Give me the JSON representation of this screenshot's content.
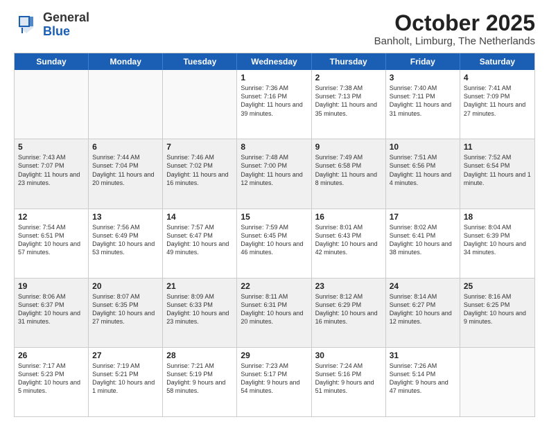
{
  "logo": {
    "general": "General",
    "blue": "Blue"
  },
  "header": {
    "month": "October 2025",
    "location": "Banholt, Limburg, The Netherlands"
  },
  "weekdays": [
    "Sunday",
    "Monday",
    "Tuesday",
    "Wednesday",
    "Thursday",
    "Friday",
    "Saturday"
  ],
  "rows": [
    [
      {
        "day": "",
        "text": "",
        "empty": true
      },
      {
        "day": "",
        "text": "",
        "empty": true
      },
      {
        "day": "",
        "text": "",
        "empty": true
      },
      {
        "day": "1",
        "text": "Sunrise: 7:36 AM\nSunset: 7:16 PM\nDaylight: 11 hours\nand 39 minutes."
      },
      {
        "day": "2",
        "text": "Sunrise: 7:38 AM\nSunset: 7:13 PM\nDaylight: 11 hours\nand 35 minutes."
      },
      {
        "day": "3",
        "text": "Sunrise: 7:40 AM\nSunset: 7:11 PM\nDaylight: 11 hours\nand 31 minutes."
      },
      {
        "day": "4",
        "text": "Sunrise: 7:41 AM\nSunset: 7:09 PM\nDaylight: 11 hours\nand 27 minutes."
      }
    ],
    [
      {
        "day": "5",
        "text": "Sunrise: 7:43 AM\nSunset: 7:07 PM\nDaylight: 11 hours\nand 23 minutes.",
        "shaded": true
      },
      {
        "day": "6",
        "text": "Sunrise: 7:44 AM\nSunset: 7:04 PM\nDaylight: 11 hours\nand 20 minutes.",
        "shaded": true
      },
      {
        "day": "7",
        "text": "Sunrise: 7:46 AM\nSunset: 7:02 PM\nDaylight: 11 hours\nand 16 minutes.",
        "shaded": true
      },
      {
        "day": "8",
        "text": "Sunrise: 7:48 AM\nSunset: 7:00 PM\nDaylight: 11 hours\nand 12 minutes.",
        "shaded": true
      },
      {
        "day": "9",
        "text": "Sunrise: 7:49 AM\nSunset: 6:58 PM\nDaylight: 11 hours\nand 8 minutes.",
        "shaded": true
      },
      {
        "day": "10",
        "text": "Sunrise: 7:51 AM\nSunset: 6:56 PM\nDaylight: 11 hours\nand 4 minutes.",
        "shaded": true
      },
      {
        "day": "11",
        "text": "Sunrise: 7:52 AM\nSunset: 6:54 PM\nDaylight: 11 hours\nand 1 minute.",
        "shaded": true
      }
    ],
    [
      {
        "day": "12",
        "text": "Sunrise: 7:54 AM\nSunset: 6:51 PM\nDaylight: 10 hours\nand 57 minutes."
      },
      {
        "day": "13",
        "text": "Sunrise: 7:56 AM\nSunset: 6:49 PM\nDaylight: 10 hours\nand 53 minutes."
      },
      {
        "day": "14",
        "text": "Sunrise: 7:57 AM\nSunset: 6:47 PM\nDaylight: 10 hours\nand 49 minutes."
      },
      {
        "day": "15",
        "text": "Sunrise: 7:59 AM\nSunset: 6:45 PM\nDaylight: 10 hours\nand 46 minutes."
      },
      {
        "day": "16",
        "text": "Sunrise: 8:01 AM\nSunset: 6:43 PM\nDaylight: 10 hours\nand 42 minutes."
      },
      {
        "day": "17",
        "text": "Sunrise: 8:02 AM\nSunset: 6:41 PM\nDaylight: 10 hours\nand 38 minutes."
      },
      {
        "day": "18",
        "text": "Sunrise: 8:04 AM\nSunset: 6:39 PM\nDaylight: 10 hours\nand 34 minutes."
      }
    ],
    [
      {
        "day": "19",
        "text": "Sunrise: 8:06 AM\nSunset: 6:37 PM\nDaylight: 10 hours\nand 31 minutes.",
        "shaded": true
      },
      {
        "day": "20",
        "text": "Sunrise: 8:07 AM\nSunset: 6:35 PM\nDaylight: 10 hours\nand 27 minutes.",
        "shaded": true
      },
      {
        "day": "21",
        "text": "Sunrise: 8:09 AM\nSunset: 6:33 PM\nDaylight: 10 hours\nand 23 minutes.",
        "shaded": true
      },
      {
        "day": "22",
        "text": "Sunrise: 8:11 AM\nSunset: 6:31 PM\nDaylight: 10 hours\nand 20 minutes.",
        "shaded": true
      },
      {
        "day": "23",
        "text": "Sunrise: 8:12 AM\nSunset: 6:29 PM\nDaylight: 10 hours\nand 16 minutes.",
        "shaded": true
      },
      {
        "day": "24",
        "text": "Sunrise: 8:14 AM\nSunset: 6:27 PM\nDaylight: 10 hours\nand 12 minutes.",
        "shaded": true
      },
      {
        "day": "25",
        "text": "Sunrise: 8:16 AM\nSunset: 6:25 PM\nDaylight: 10 hours\nand 9 minutes.",
        "shaded": true
      }
    ],
    [
      {
        "day": "26",
        "text": "Sunrise: 7:17 AM\nSunset: 5:23 PM\nDaylight: 10 hours\nand 5 minutes."
      },
      {
        "day": "27",
        "text": "Sunrise: 7:19 AM\nSunset: 5:21 PM\nDaylight: 10 hours\nand 1 minute."
      },
      {
        "day": "28",
        "text": "Sunrise: 7:21 AM\nSunset: 5:19 PM\nDaylight: 9 hours\nand 58 minutes."
      },
      {
        "day": "29",
        "text": "Sunrise: 7:23 AM\nSunset: 5:17 PM\nDaylight: 9 hours\nand 54 minutes."
      },
      {
        "day": "30",
        "text": "Sunrise: 7:24 AM\nSunset: 5:16 PM\nDaylight: 9 hours\nand 51 minutes."
      },
      {
        "day": "31",
        "text": "Sunrise: 7:26 AM\nSunset: 5:14 PM\nDaylight: 9 hours\nand 47 minutes."
      },
      {
        "day": "",
        "text": "",
        "empty": true
      }
    ]
  ]
}
